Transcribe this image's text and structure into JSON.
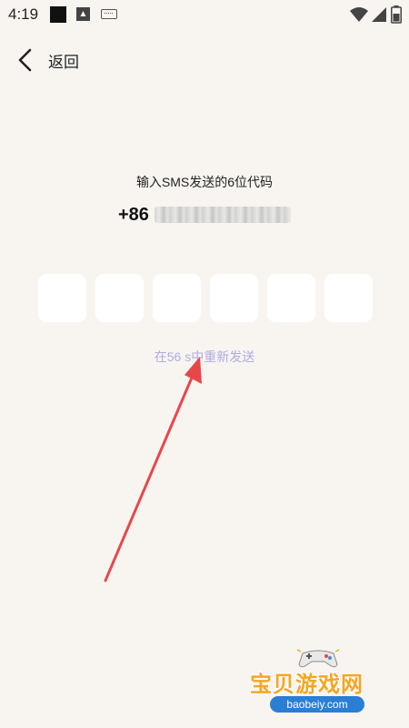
{
  "status_bar": {
    "time": "4:19",
    "icons": [
      "stop-square-icon",
      "a-badge-icon",
      "keyboard-icon",
      "wifi-icon",
      "signal-icon",
      "battery-icon"
    ]
  },
  "header": {
    "back_label": "返回",
    "back_icon": "chevron-left-icon"
  },
  "verification": {
    "instruction": "输入SMS发送的6位代码",
    "phone_prefix": "+86",
    "code_digits": [
      "",
      "",
      "",
      "",
      "",
      ""
    ],
    "resend_text": "在56 s中重新发送"
  },
  "watermark": {
    "title": "宝贝游戏网",
    "url": "baobeiy.com",
    "icon": "gamepad-icon"
  },
  "colors": {
    "background": "#f8f5f1",
    "resend_text": "#b1abe0",
    "arrow": "#e8474a",
    "watermark_title": "#f5a623",
    "watermark_url_bg": "#2a7fd4"
  }
}
